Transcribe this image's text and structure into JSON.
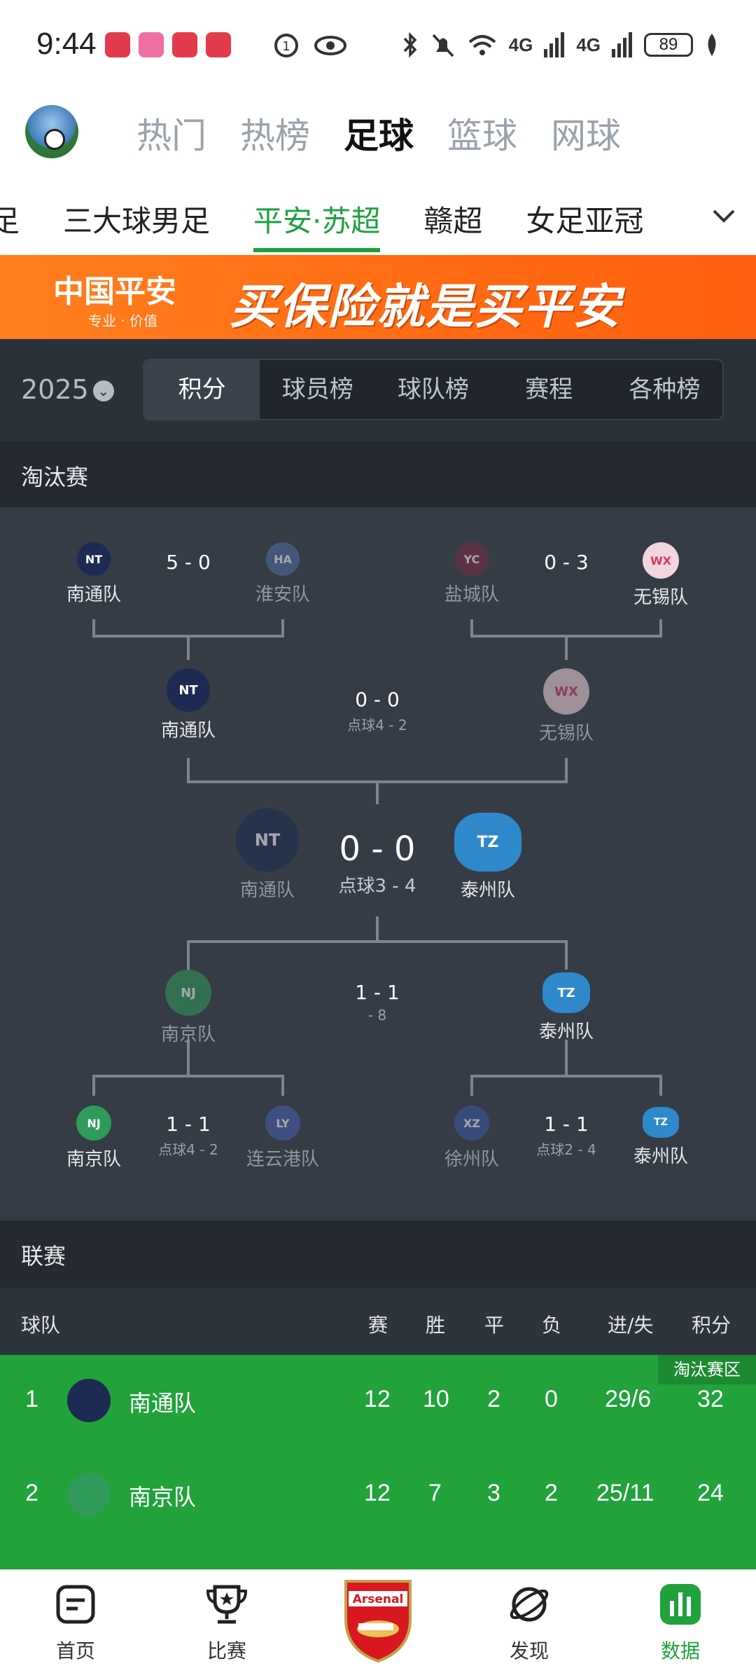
{
  "status_bar": {
    "time": "9:44",
    "battery": "89",
    "net1": "4G",
    "net2": "4G"
  },
  "top_nav": {
    "tabs": [
      "热门",
      "热榜",
      "足球",
      "篮球",
      "网球"
    ],
    "active_index": 2
  },
  "league_tabs": {
    "items": [
      "足",
      "三大球男足",
      "平安·苏超",
      "赣超",
      "女足亚冠"
    ],
    "active_index": 2
  },
  "banner": {
    "brand": "中国平安",
    "sub": "专业 · 价值",
    "slogan": "买保险就是买平安"
  },
  "season": {
    "year": "2025"
  },
  "segments": {
    "items": [
      "积分",
      "球员榜",
      "球队榜",
      "赛程",
      "各种榜"
    ],
    "active_index": 0
  },
  "knockout": {
    "title": "淘汰赛",
    "r1_top_left": {
      "home": "南通队",
      "away": "淮安队",
      "score": "5 - 0"
    },
    "r1_top_right": {
      "home": "盐城队",
      "away": "无锡队",
      "score": "0 - 3"
    },
    "semi_top": {
      "home": "南通队",
      "away": "无锡队",
      "score": "0 - 0",
      "pens": "点球4 - 2"
    },
    "final": {
      "home": "南通队",
      "away": "泰州队",
      "score": "0 - 0",
      "pens": "点球3 - 4"
    },
    "semi_bottom": {
      "home": "南京队",
      "away": "泰州队",
      "score": "1 - 1",
      "pens": "- 8"
    },
    "r1_bot_left": {
      "home": "南京队",
      "away": "连云港队",
      "score": "1 - 1",
      "pens": "点球4 - 2"
    },
    "r1_bot_right": {
      "home": "徐州队",
      "away": "泰州队",
      "score": "1 - 1",
      "pens": "点球2 - 4"
    }
  },
  "league": {
    "title": "联赛",
    "headers": {
      "team": "球队",
      "played": "赛",
      "win": "胜",
      "draw": "平",
      "loss": "负",
      "gd": "进/失",
      "pts": "积分"
    },
    "zone_tag": "淘汰赛区",
    "rows": [
      {
        "rank": "1",
        "team": "南通队",
        "played": "12",
        "win": "10",
        "draw": "2",
        "loss": "0",
        "gd": "29/6",
        "pts": "32"
      },
      {
        "rank": "2",
        "team": "南京队",
        "played": "12",
        "win": "7",
        "draw": "3",
        "loss": "2",
        "gd": "25/11",
        "pts": "24"
      }
    ]
  },
  "bottom_nav": {
    "items": [
      "首页",
      "比赛",
      "发现",
      "数据"
    ],
    "center_logo": "Arsenal",
    "active_index": 3
  },
  "colors": {
    "accent": "#1fa13c",
    "dark_bg": "#2b3138",
    "banner": "#ff6a12"
  }
}
